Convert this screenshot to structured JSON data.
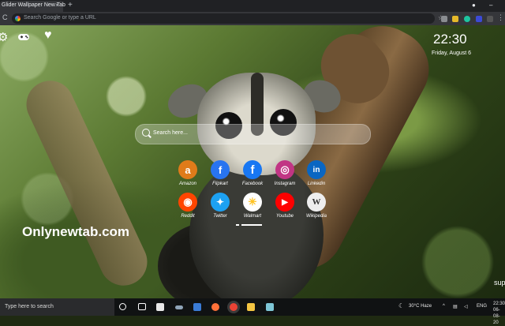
{
  "browser": {
    "tab_title": "Glider Wallpaper New Tab",
    "tab_close": "×",
    "new_tab": "+",
    "window_close": "●",
    "window_min": "–",
    "reload": "C",
    "omnibox_placeholder": "Search Google or type a URL",
    "menu": "⋮"
  },
  "widgets": {
    "time": "22:30",
    "date": "Friday, August 6",
    "search_placeholder": "Search here..."
  },
  "shortcuts": [
    {
      "label": "Amazon",
      "glyph": "a",
      "color": "#e07b1a"
    },
    {
      "label": "Flipkart",
      "glyph": "f",
      "color": "#2874f0"
    },
    {
      "label": "Facebook",
      "glyph": "f",
      "color": "#1877f2"
    },
    {
      "label": "Instagram",
      "glyph": "◎",
      "color": "#c13584"
    },
    {
      "label": "Linkedin",
      "glyph": "in",
      "color": "#0a66c2"
    },
    {
      "label": "Reddit",
      "glyph": "◉",
      "color": "#ff4500"
    },
    {
      "label": "Twitter",
      "glyph": "✦",
      "color": "#1da1f2"
    },
    {
      "label": "Walmart",
      "glyph": "✳",
      "color": "#ffffff"
    },
    {
      "label": "Youtube",
      "glyph": "▶",
      "color": "#ff0000"
    },
    {
      "label": "Wikipedia",
      "glyph": "W",
      "color": "#eeeeee"
    }
  ],
  "brand": "Onlynewtab.com",
  "edge_text": "sup",
  "taskbar": {
    "search_placeholder": "Type here to search",
    "weather": "30°C  Haze",
    "language": "ENG",
    "time": "22:30",
    "date": "06-08-20"
  }
}
